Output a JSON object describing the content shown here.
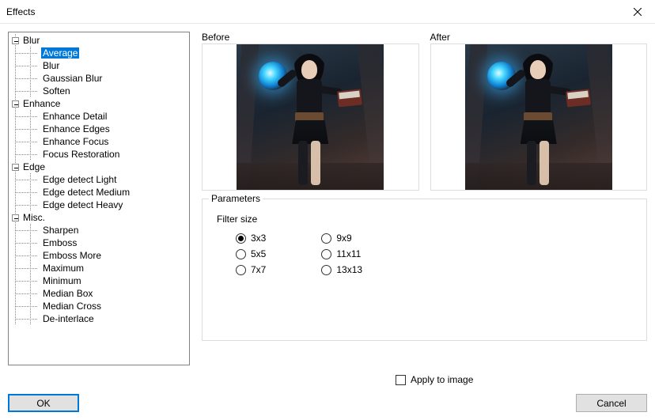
{
  "window": {
    "title": "Effects"
  },
  "tree": [
    {
      "label": "Blur",
      "level": 0,
      "expanded": true
    },
    {
      "label": "Average",
      "level": 1,
      "selected": true
    },
    {
      "label": "Blur",
      "level": 1
    },
    {
      "label": "Gaussian Blur",
      "level": 1
    },
    {
      "label": "Soften",
      "level": 1
    },
    {
      "label": "Enhance",
      "level": 0,
      "expanded": true
    },
    {
      "label": "Enhance Detail",
      "level": 1
    },
    {
      "label": "Enhance Edges",
      "level": 1
    },
    {
      "label": "Enhance Focus",
      "level": 1
    },
    {
      "label": "Focus Restoration",
      "level": 1
    },
    {
      "label": "Edge",
      "level": 0,
      "expanded": true
    },
    {
      "label": "Edge detect Light",
      "level": 1
    },
    {
      "label": "Edge detect Medium",
      "level": 1
    },
    {
      "label": "Edge detect Heavy",
      "level": 1
    },
    {
      "label": "Misc.",
      "level": 0,
      "expanded": true
    },
    {
      "label": "Sharpen",
      "level": 1
    },
    {
      "label": "Emboss",
      "level": 1
    },
    {
      "label": "Emboss More",
      "level": 1
    },
    {
      "label": "Maximum",
      "level": 1
    },
    {
      "label": "Minimum",
      "level": 1
    },
    {
      "label": "Median Box",
      "level": 1
    },
    {
      "label": "Median Cross",
      "level": 1
    },
    {
      "label": "De-interlace",
      "level": 1
    }
  ],
  "preview": {
    "before_label": "Before",
    "after_label": "After"
  },
  "parameters": {
    "group_title": "Parameters",
    "filter_label": "Filter size",
    "options_col1": [
      {
        "label": "3x3",
        "checked": true
      },
      {
        "label": "5x5",
        "checked": false
      },
      {
        "label": "7x7",
        "checked": false
      }
    ],
    "options_col2": [
      {
        "label": "9x9",
        "checked": false
      },
      {
        "label": "11x11",
        "checked": false
      },
      {
        "label": "13x13",
        "checked": false
      }
    ]
  },
  "apply": {
    "label": "Apply to image",
    "checked": false
  },
  "buttons": {
    "ok": "OK",
    "cancel": "Cancel"
  }
}
